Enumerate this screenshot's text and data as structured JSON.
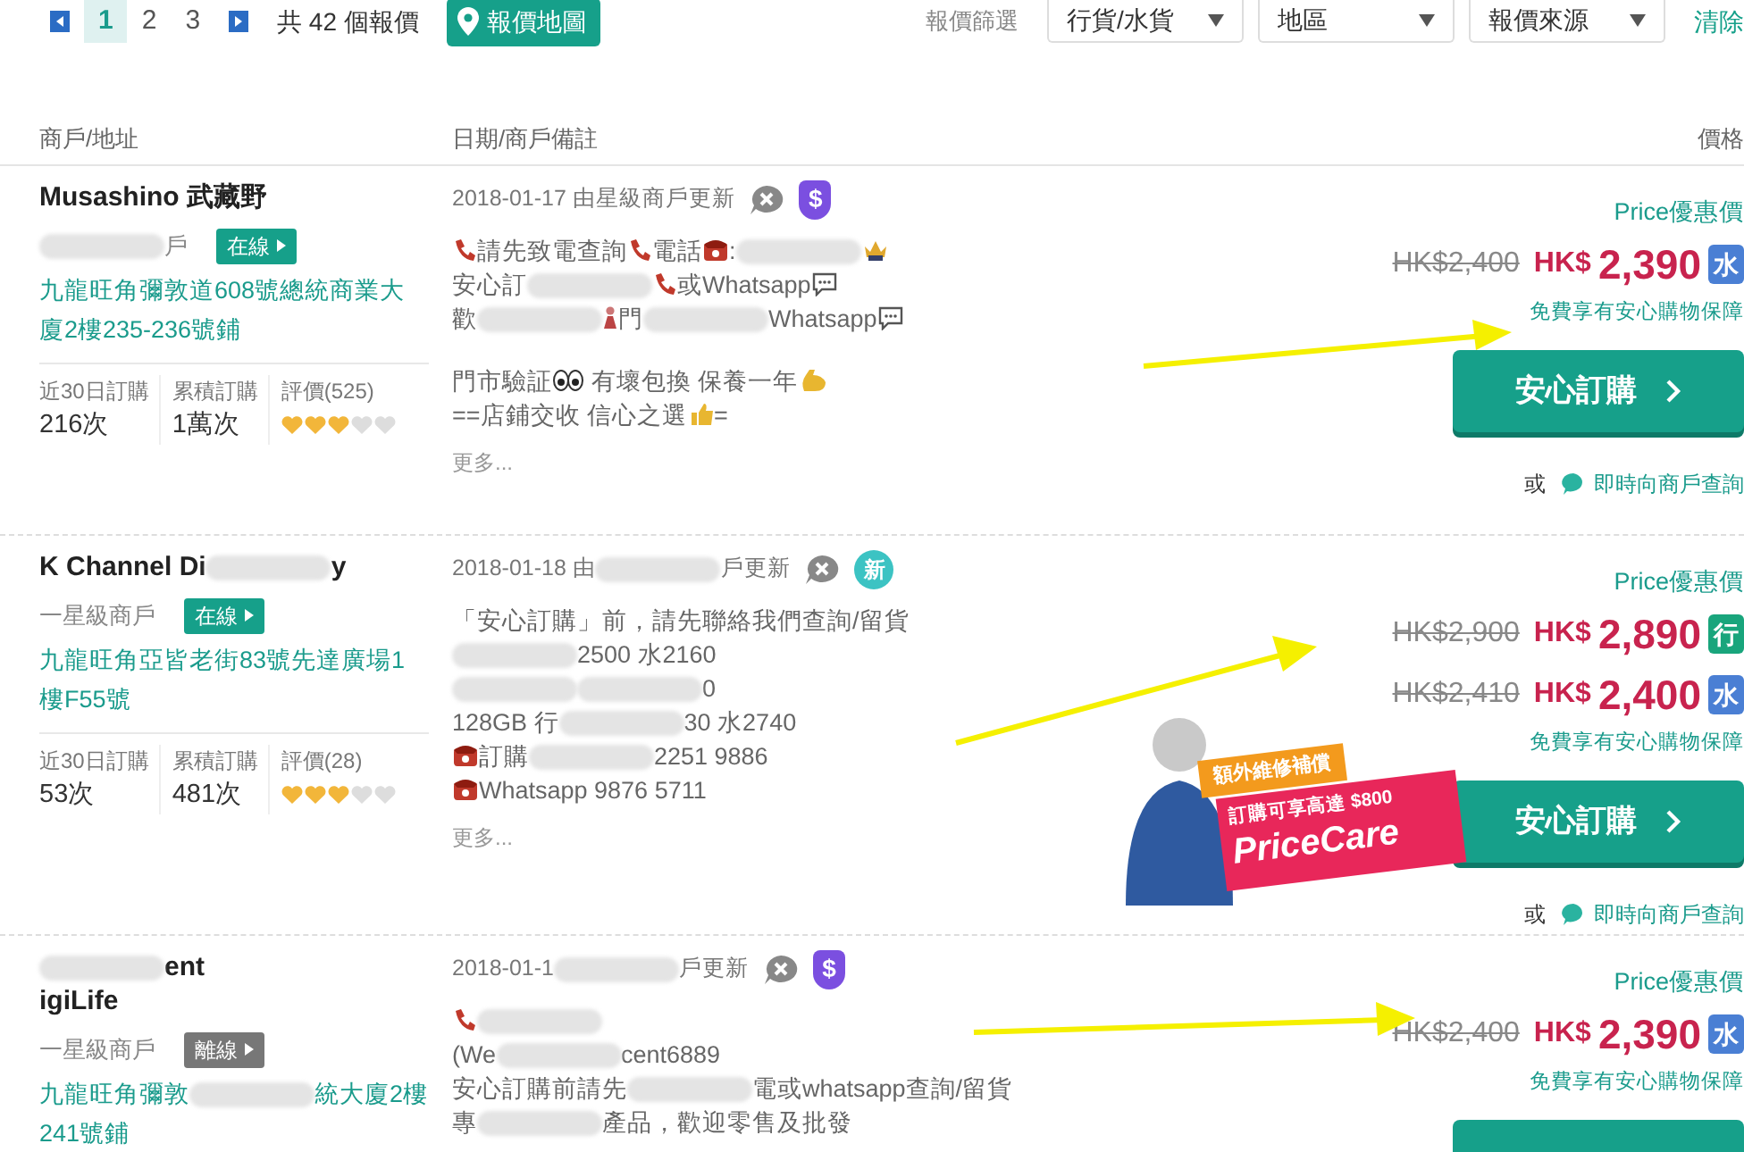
{
  "toolbar": {
    "pages": [
      {
        "label": "1",
        "selected": true
      },
      {
        "label": "2",
        "selected": false
      },
      {
        "label": "3",
        "selected": false
      }
    ],
    "count": "共 42 個報價",
    "map_button": "報價地圖",
    "filter_label": "報價篩選",
    "filters": [
      {
        "label": "行貨/水貨"
      },
      {
        "label": "地區"
      },
      {
        "label": "報價來源"
      }
    ],
    "clear": "清除"
  },
  "columns": [
    "商戶/地址",
    "日期/商戶備註",
    "價格"
  ],
  "listings": [
    {
      "merchant": {
        "name_lines": [
          [
            {
              "kind": "text",
              "text": "Musashino 武藏野"
            }
          ]
        ],
        "level": [
          {
            "kind": "blur"
          },
          {
            "kind": "text",
            "text": "戶"
          }
        ],
        "status": {
          "label": "在線",
          "online": true
        },
        "address": [
          {
            "kind": "text",
            "text": "九龍旺角彌敦道608號總統商業大廈2樓235-236號鋪"
          }
        ],
        "stats": [
          {
            "label": "近30日訂購",
            "value": "216次"
          },
          {
            "label": "累積訂購",
            "value": "1萬次"
          }
        ],
        "rating": "評價(525)",
        "stars": 3
      },
      "notes": {
        "date": [
          {
            "kind": "text",
            "text": "2018-01-17 由星級商戶更新"
          }
        ],
        "badge": {
          "kind": "dollar",
          "text": "$"
        },
        "paragraphs": [
          [
            [
              {
                "kind": "phone"
              },
              {
                "kind": "text",
                "text": "請先致電查詢"
              },
              {
                "kind": "phone"
              },
              {
                "kind": "text",
                "text": "電話"
              },
              {
                "kind": "telephone"
              },
              {
                "kind": "text",
                "text": ":"
              },
              {
                "kind": "blur"
              },
              {
                "kind": "crown"
              }
            ],
            [
              {
                "kind": "text",
                "text": "安心訂"
              },
              {
                "kind": "blur"
              },
              {
                "kind": "phone"
              },
              {
                "kind": "text",
                "text": "或Whatsapp"
              },
              {
                "kind": "chat"
              }
            ],
            [
              {
                "kind": "text",
                "text": "歡"
              },
              {
                "kind": "blur"
              },
              {
                "kind": "figure"
              },
              {
                "kind": "text",
                "text": "門"
              },
              {
                "kind": "blur"
              },
              {
                "kind": "text",
                "text": "Whatsapp"
              },
              {
                "kind": "chat"
              }
            ]
          ],
          [
            [
              {
                "kind": "text",
                "text": "門市驗証"
              },
              {
                "kind": "eyes"
              },
              {
                "kind": "text",
                "text": " 有壞包換 保養一年"
              },
              {
                "kind": "arm"
              }
            ],
            [
              {
                "kind": "text",
                "text": "==店鋪交收 信心之選"
              },
              {
                "kind": "thumb"
              },
              {
                "kind": "text",
                "text": "="
              }
            ]
          ]
        ],
        "more": "更多..."
      },
      "prices": {
        "label": "Price優惠價",
        "offers": [
          {
            "was": "HK$2,400",
            "currency": "HK$",
            "price": "2,390",
            "tag": "水",
            "color": "#4a7fd4"
          }
        ],
        "guarantee": "免費享有安心購物保障",
        "buy": "安心訂購",
        "or": "或",
        "chat": "即時向商戶查詢"
      }
    },
    {
      "merchant": {
        "name_lines": [
          [
            {
              "kind": "text",
              "text": "K Channel Di"
            },
            {
              "kind": "blur"
            },
            {
              "kind": "text",
              "text": "y"
            }
          ]
        ],
        "level": [
          {
            "kind": "text",
            "text": "一星級商戶"
          }
        ],
        "status": {
          "label": "在線",
          "online": true
        },
        "address": [
          {
            "kind": "text",
            "text": "九龍旺角亞皆老街83號先達廣場1樓F55號"
          }
        ],
        "stats": [
          {
            "label": "近30日訂購",
            "value": "53次"
          },
          {
            "label": "累積訂購",
            "value": "481次"
          }
        ],
        "rating": "評價(28)",
        "stars": 3
      },
      "notes": {
        "date": [
          {
            "kind": "text",
            "text": "2018-01-18 由"
          },
          {
            "kind": "blur"
          },
          {
            "kind": "text",
            "text": "戶更新"
          }
        ],
        "badge": {
          "kind": "new",
          "text": "新"
        },
        "paragraphs": [
          [
            [
              {
                "kind": "text",
                "text": "「安心訂購」前，請先聯絡我們查詢/留貨"
              }
            ],
            [
              {
                "kind": "blur"
              },
              {
                "kind": "text",
                "text": "2500 水2160"
              }
            ],
            [
              {
                "kind": "blur"
              },
              {
                "kind": "blur"
              },
              {
                "kind": "text",
                "text": "0"
              }
            ],
            [
              {
                "kind": "text",
                "text": "128GB 行"
              },
              {
                "kind": "blur"
              },
              {
                "kind": "text",
                "text": "30 水2740"
              }
            ],
            [
              {
                "kind": "telephone"
              },
              {
                "kind": "text",
                "text": "訂購"
              },
              {
                "kind": "blur"
              },
              {
                "kind": "text",
                "text": "2251 9886"
              }
            ],
            [
              {
                "kind": "telephone"
              },
              {
                "kind": "text",
                "text": "Whatsapp 9876 5711"
              }
            ]
          ]
        ],
        "more": "更多..."
      },
      "prices": {
        "label": "Price優惠價",
        "offers": [
          {
            "was": "HK$2,900",
            "currency": "HK$",
            "price": "2,890",
            "tag": "行",
            "color": "#19a57c"
          },
          {
            "was": "HK$2,410",
            "currency": "HK$",
            "price": "2,400",
            "tag": "水",
            "color": "#4a7fd4"
          }
        ],
        "guarantee": "免費享有安心購物保障",
        "buy": "安心訂購",
        "or": "或",
        "chat": "即時向商戶查詢",
        "promo": {
          "ribbon": "額外維修補償",
          "offer": "訂購可享高達 $800",
          "brand": "PriceCare"
        }
      }
    },
    {
      "merchant": {
        "name_lines": [
          [
            {
              "kind": "blur"
            },
            {
              "kind": "text",
              "text": "ent"
            }
          ],
          [
            {
              "kind": "text",
              "text": "igiLife"
            }
          ]
        ],
        "level": [
          {
            "kind": "text",
            "text": "一星級商戶"
          }
        ],
        "status": {
          "label": "離線",
          "online": false
        },
        "address": [
          {
            "kind": "text",
            "text": "九龍旺角彌敦"
          },
          {
            "kind": "blur"
          },
          {
            "kind": "text",
            "text": "統大廈2樓241號鋪"
          }
        ]
      },
      "notes": {
        "date": [
          {
            "kind": "text",
            "text": "2018-01-1"
          },
          {
            "kind": "blur"
          },
          {
            "kind": "text",
            "text": "戶更新"
          }
        ],
        "badge": {
          "kind": "dollar",
          "text": "$"
        },
        "paragraphs": [
          [
            [
              {
                "kind": "phone"
              },
              {
                "kind": "blur"
              }
            ],
            [
              {
                "kind": "text",
                "text": "(We"
              },
              {
                "kind": "blur"
              },
              {
                "kind": "text",
                "text": "cent6889"
              }
            ],
            [
              {
                "kind": "text",
                "text": "安心訂購前請先"
              },
              {
                "kind": "blur"
              },
              {
                "kind": "text",
                "text": "電或whatsapp查詢/留貨"
              }
            ],
            [
              {
                "kind": "text",
                "text": "專"
              },
              {
                "kind": "blur"
              },
              {
                "kind": "text",
                "text": "產品，歡迎零售及批發"
              }
            ]
          ]
        ]
      },
      "prices": {
        "label": "Price優惠價",
        "offers": [
          {
            "was": "HK$2,400",
            "currency": "HK$",
            "price": "2,390",
            "tag": "水",
            "color": "#4a7fd4"
          }
        ],
        "guarantee": "免費享有安心購物保障"
      }
    }
  ]
}
